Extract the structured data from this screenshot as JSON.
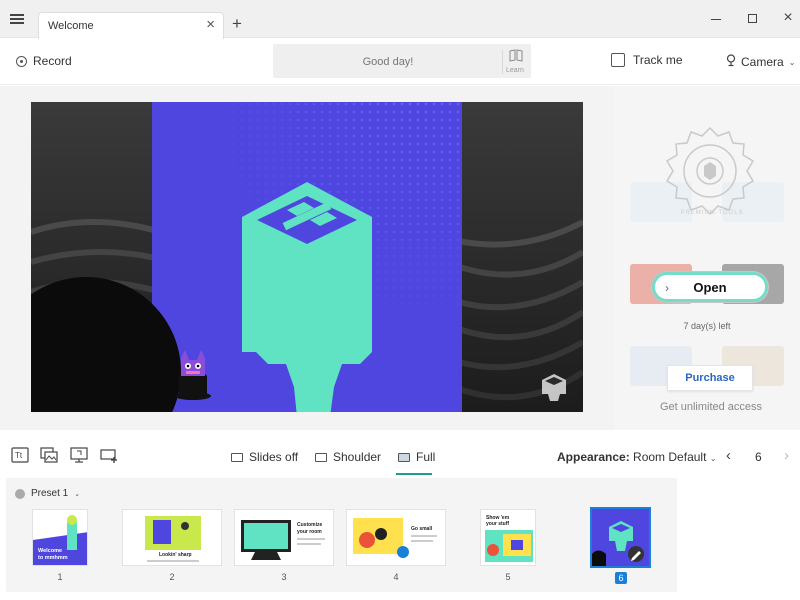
{
  "window": {
    "tab_title": "Welcome",
    "tab_close": "×",
    "new_tab": "+",
    "minimize": "minimize",
    "maximize": "maximize",
    "close": "×"
  },
  "toolbar": {
    "record_label": "Record",
    "teleprompter_text": "Good day!",
    "learn_label": "Learn",
    "track_me_label": "Track me",
    "track_me_checked": false,
    "camera_label": "Camera"
  },
  "side_panel": {
    "open_label": "Open",
    "days_left": "7 day(s) left",
    "purchase_label": "Purchase",
    "unlimited_label": "Get unlimited access",
    "seal_text": "PREMIUM TOOLS"
  },
  "bottom": {
    "modes": [
      {
        "label": "Slides off",
        "active": false
      },
      {
        "label": "Shoulder",
        "active": false
      },
      {
        "label": "Full",
        "active": true
      }
    ],
    "appearance_label": "Appearance:",
    "appearance_value": "Room Default",
    "page": "6"
  },
  "slides": {
    "preset_label": "Preset 1",
    "items": [
      {
        "num": "1",
        "caption": "Welcome to mmhmm"
      },
      {
        "num": "2",
        "caption": "Lookin' sharp"
      },
      {
        "num": "3",
        "caption": "Customize your room"
      },
      {
        "num": "4",
        "caption": "Go small"
      },
      {
        "num": "5",
        "caption": "Show 'em your stuff"
      },
      {
        "num": "6",
        "caption": ""
      }
    ],
    "selected": "6"
  },
  "colors": {
    "slide_blue": "#4f46e0",
    "logo_mint": "#5fe3c2",
    "accent_teal": "#1f9d8a",
    "open_ring": "#76dcc7",
    "purchase_blue": "#2b66c0",
    "selected_blue": "#1a7fd6"
  },
  "icons": {
    "menu": "hamburger-icon",
    "record": "record-icon",
    "learn": "book-icon",
    "camera": "camera-icon",
    "text_tool": "text-icon",
    "image_tool": "image-icon",
    "screen_tool": "screen-share-icon",
    "add_slide": "add-slide-icon"
  }
}
